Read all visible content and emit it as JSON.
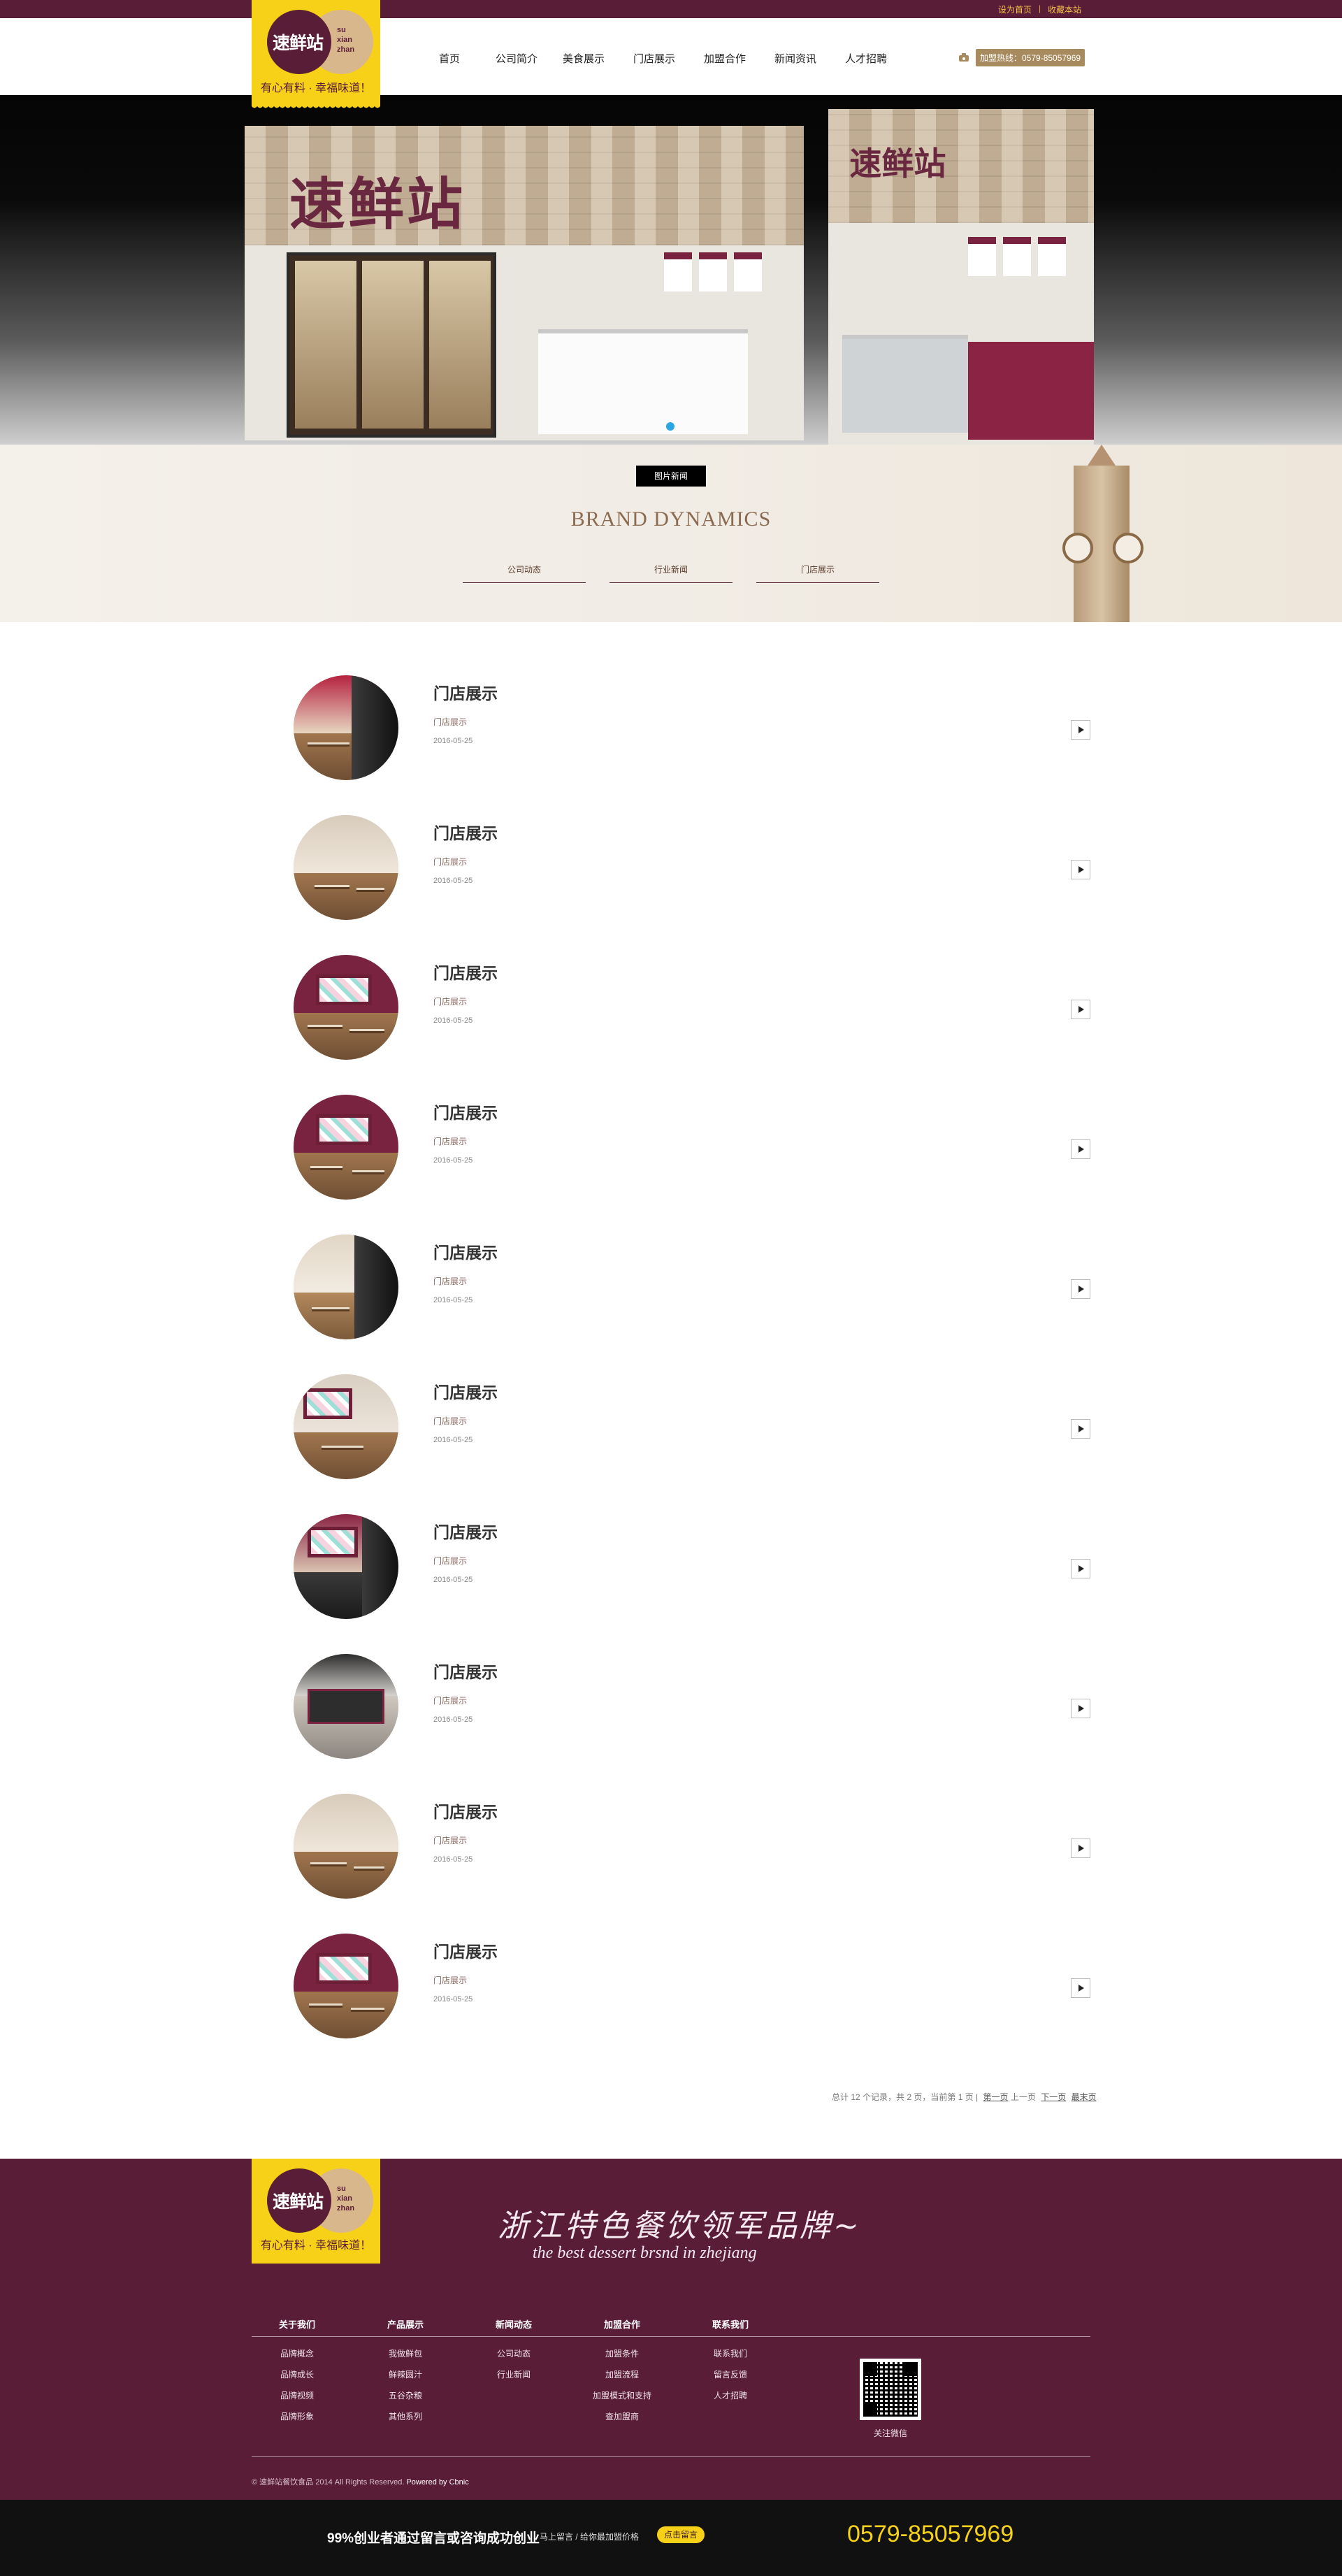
{
  "topbar": {
    "set_home": "设为首页",
    "bookmark": "收藏本站"
  },
  "logo": {
    "cn": "速鲜站",
    "en1": "su",
    "en2": "xian",
    "en3": "zhan",
    "slogan": "有心有料 · 幸福味道！"
  },
  "nav": [
    "首页",
    "公司简介",
    "美食展示",
    "门店展示",
    "加盟合作",
    "新闻资讯",
    "人才招聘"
  ],
  "hotline": "加盟热线：0579-85057969",
  "banner": {
    "store_left_sign": "速鲜站",
    "store_right_sign": "速鲜站"
  },
  "dynamics": {
    "tag": "图片新闻",
    "title": "BRAND DYNAMICS",
    "tabs": [
      "公司动态",
      "行业新闻",
      "门店展示"
    ]
  },
  "items": [
    {
      "title": "门店展示",
      "category": "门店展示",
      "date": "2016-05-25"
    },
    {
      "title": "门店展示",
      "category": "门店展示",
      "date": "2016-05-25"
    },
    {
      "title": "门店展示",
      "category": "门店展示",
      "date": "2016-05-25"
    },
    {
      "title": "门店展示",
      "category": "门店展示",
      "date": "2016-05-25"
    },
    {
      "title": "门店展示",
      "category": "门店展示",
      "date": "2016-05-25"
    },
    {
      "title": "门店展示",
      "category": "门店展示",
      "date": "2016-05-25"
    },
    {
      "title": "门店展示",
      "category": "门店展示",
      "date": "2016-05-25"
    },
    {
      "title": "门店展示",
      "category": "门店展示",
      "date": "2016-05-25"
    },
    {
      "title": "门店展示",
      "category": "门店展示",
      "date": "2016-05-25"
    },
    {
      "title": "门店展示",
      "category": "门店展示",
      "date": "2016-05-25"
    }
  ],
  "pager": {
    "summary": "总计 12 个记录，共 2 页，当前第 1 页 |",
    "first": "第一页",
    "prev": "上一页",
    "next": "下一页",
    "last": "最末页"
  },
  "footer": {
    "slogan_cn": "浙江特色餐饮领军品牌~",
    "slogan_en": "the best dessert brsnd in zhejiang",
    "columns": [
      {
        "head": "关于我们",
        "items": [
          "品牌概念",
          "品牌成长",
          "品牌视频",
          "品牌形象"
        ]
      },
      {
        "head": "产品展示",
        "items": [
          "我做鲜包",
          "鲜辣圆汁",
          "五谷杂粮",
          "其他系列"
        ]
      },
      {
        "head": "新闻动态",
        "items": [
          "公司动态",
          "行业新闻"
        ]
      },
      {
        "head": "加盟合作",
        "items": [
          "加盟条件",
          "加盟流程",
          "加盟模式和支持",
          "查加盟商"
        ]
      },
      {
        "head": "联系我们",
        "items": [
          "联系我们",
          "留言反馈",
          "人才招聘"
        ]
      }
    ],
    "qr_label": "关注微信",
    "copyright": "© 速鲜站餐饮食品 2014 All Rights Reserved.",
    "powered": "Powered by Cbnic"
  },
  "bottom": {
    "message": "99%创业者通过留言或咨询成功创业",
    "small": "马上留言 / 给你最加盟价格",
    "button": "点击留言",
    "tel": "0579-85057969"
  }
}
